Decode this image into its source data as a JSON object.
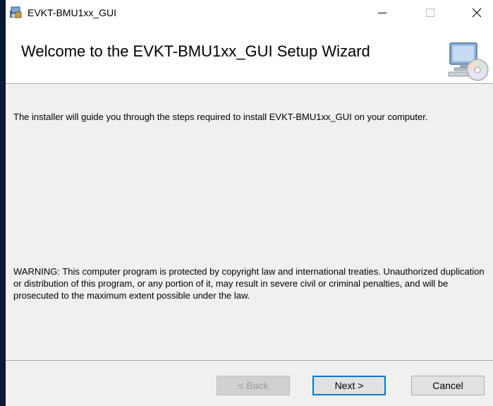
{
  "window": {
    "title": "EVKT-BMU1xx_GUI"
  },
  "banner": {
    "title": "Welcome to the EVKT-BMU1xx_GUI Setup Wizard",
    "icon": "installer-computer-cd-icon"
  },
  "content": {
    "intro": "The installer will guide you through the steps required to install EVKT-BMU1xx_GUI on your computer.",
    "warning": "WARNING: This computer program is protected by copyright law and international treaties. Unauthorized duplication or distribution of this program, or any portion of it, may result in severe civil or criminal penalties, and will be prosecuted to the maximum extent possible under the law."
  },
  "buttons": {
    "back": "< Back",
    "next": "Next >",
    "cancel": "Cancel"
  },
  "colors": {
    "focus_border": "#0078d7",
    "dialog_bg": "#f0f0f0"
  }
}
